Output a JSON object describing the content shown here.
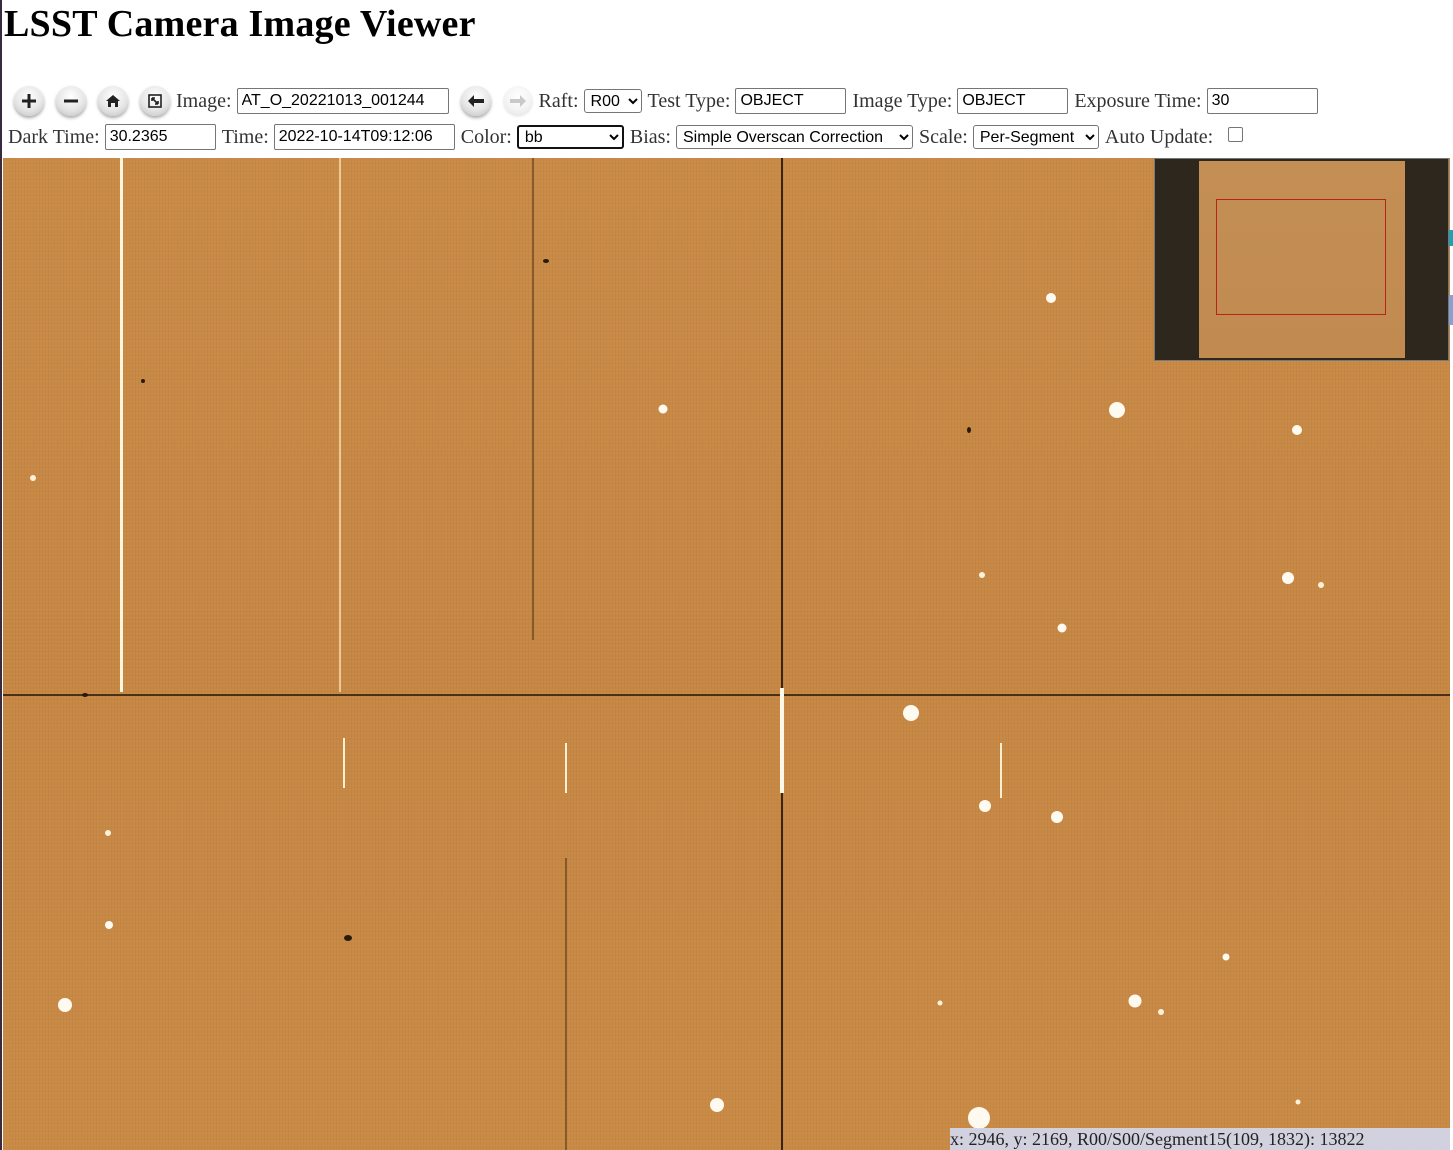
{
  "page": {
    "title": "LSST Camera Image Viewer"
  },
  "toolbar": {
    "zoom_in_icon": "plus-icon",
    "zoom_out_icon": "minus-icon",
    "home_icon": "home-icon",
    "fullscreen_icon": "fullscreen-icon",
    "image_label": "Image:",
    "image_value": "AT_O_20221013_001244",
    "prev_icon": "arrow-left-icon",
    "next_icon": "arrow-right-icon",
    "raft_label": "Raft:",
    "raft_value": "R00",
    "test_type_label": "Test Type:",
    "test_type_value": "OBJECT",
    "image_type_label": "Image Type:",
    "image_type_value": "OBJECT",
    "exposure_label": "Exposure Time:",
    "exposure_value": "30",
    "dark_time_label": "Dark Time:",
    "dark_time_value": "30.2365",
    "time_label": "Time:",
    "time_value": "2022-10-14T09:12:06",
    "color_label": "Color:",
    "color_value": "bb",
    "bias_label": "Bias:",
    "bias_value": "Simple Overscan Correction",
    "scale_label": "Scale:",
    "scale_value": "Per-Segment",
    "auto_update_label": "Auto Update:",
    "auto_update_checked": false
  },
  "status": {
    "text": "x: 2946, y: 2169, R00/S00/Segment15(109, 1832): 13822"
  },
  "colors": {
    "image_base": "#c68845",
    "navigator_view_rect": "#b8231a",
    "status_bg": "#d2d7eb"
  }
}
